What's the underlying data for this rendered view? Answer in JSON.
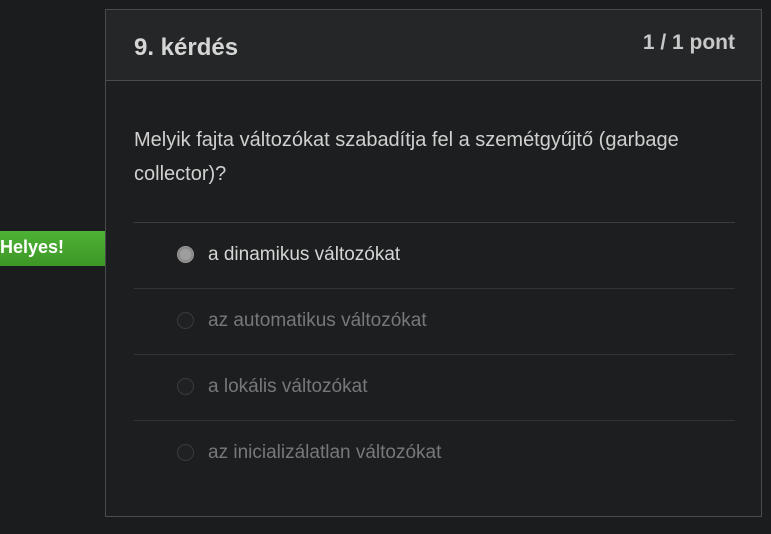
{
  "question": {
    "title": "9. kérdés",
    "points": "1 / 1 pont",
    "text": "Melyik fajta változókat szabadítja fel a szemétgyűjtő (garbage collector)?",
    "feedback_label": "Helyes!",
    "feedback_color": "#47a92f",
    "answers": [
      {
        "label": "a dinamikus változókat"
      },
      {
        "label": "az automatikus változókat"
      },
      {
        "label": "a lokális változókat"
      },
      {
        "label": "az inicializálatlan változókat"
      }
    ]
  }
}
